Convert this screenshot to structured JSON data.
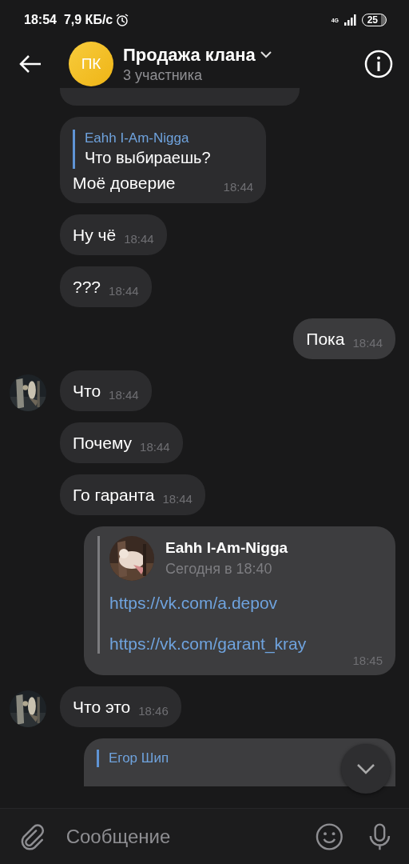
{
  "status_bar": {
    "time": "18:54",
    "speed": "7,9 КБ/с",
    "network": "4G",
    "battery": "25"
  },
  "header": {
    "avatar_initials": "ПК",
    "title": "Продажа клана",
    "subtitle": "3 участника"
  },
  "messages": [
    {
      "kind": "cut"
    },
    {
      "kind": "incoming",
      "avatar": false,
      "reply": {
        "author": "Eahh I-Am-Nigga",
        "text": "Что выбираешь?"
      },
      "text": "Моё доверие",
      "time": "18:44"
    },
    {
      "kind": "incoming",
      "avatar": false,
      "text": "Ну чё",
      "time": "18:44"
    },
    {
      "kind": "incoming",
      "avatar": false,
      "text": "???",
      "time": "18:44"
    },
    {
      "kind": "outgoing",
      "text": "Пока",
      "time": "18:44"
    },
    {
      "kind": "incoming",
      "avatar": true,
      "text": "Что",
      "time": "18:44"
    },
    {
      "kind": "incoming",
      "avatar": false,
      "text": "Почему",
      "time": "18:44"
    },
    {
      "kind": "incoming",
      "avatar": false,
      "text": "Го гаранта",
      "time": "18:44"
    },
    {
      "kind": "forward",
      "author": "Eahh I-Am-Nigga",
      "date": "Сегодня в 18:40",
      "links": [
        "https://vk.com/a.depov",
        "https://vk.com/garant_kray"
      ],
      "time": "18:45"
    },
    {
      "kind": "incoming",
      "avatar": true,
      "text": "Что это",
      "time": "18:46"
    },
    {
      "kind": "reply_cut",
      "reply": {
        "author": "Егор Шип"
      }
    }
  ],
  "composer": {
    "placeholder": "Сообщение"
  }
}
